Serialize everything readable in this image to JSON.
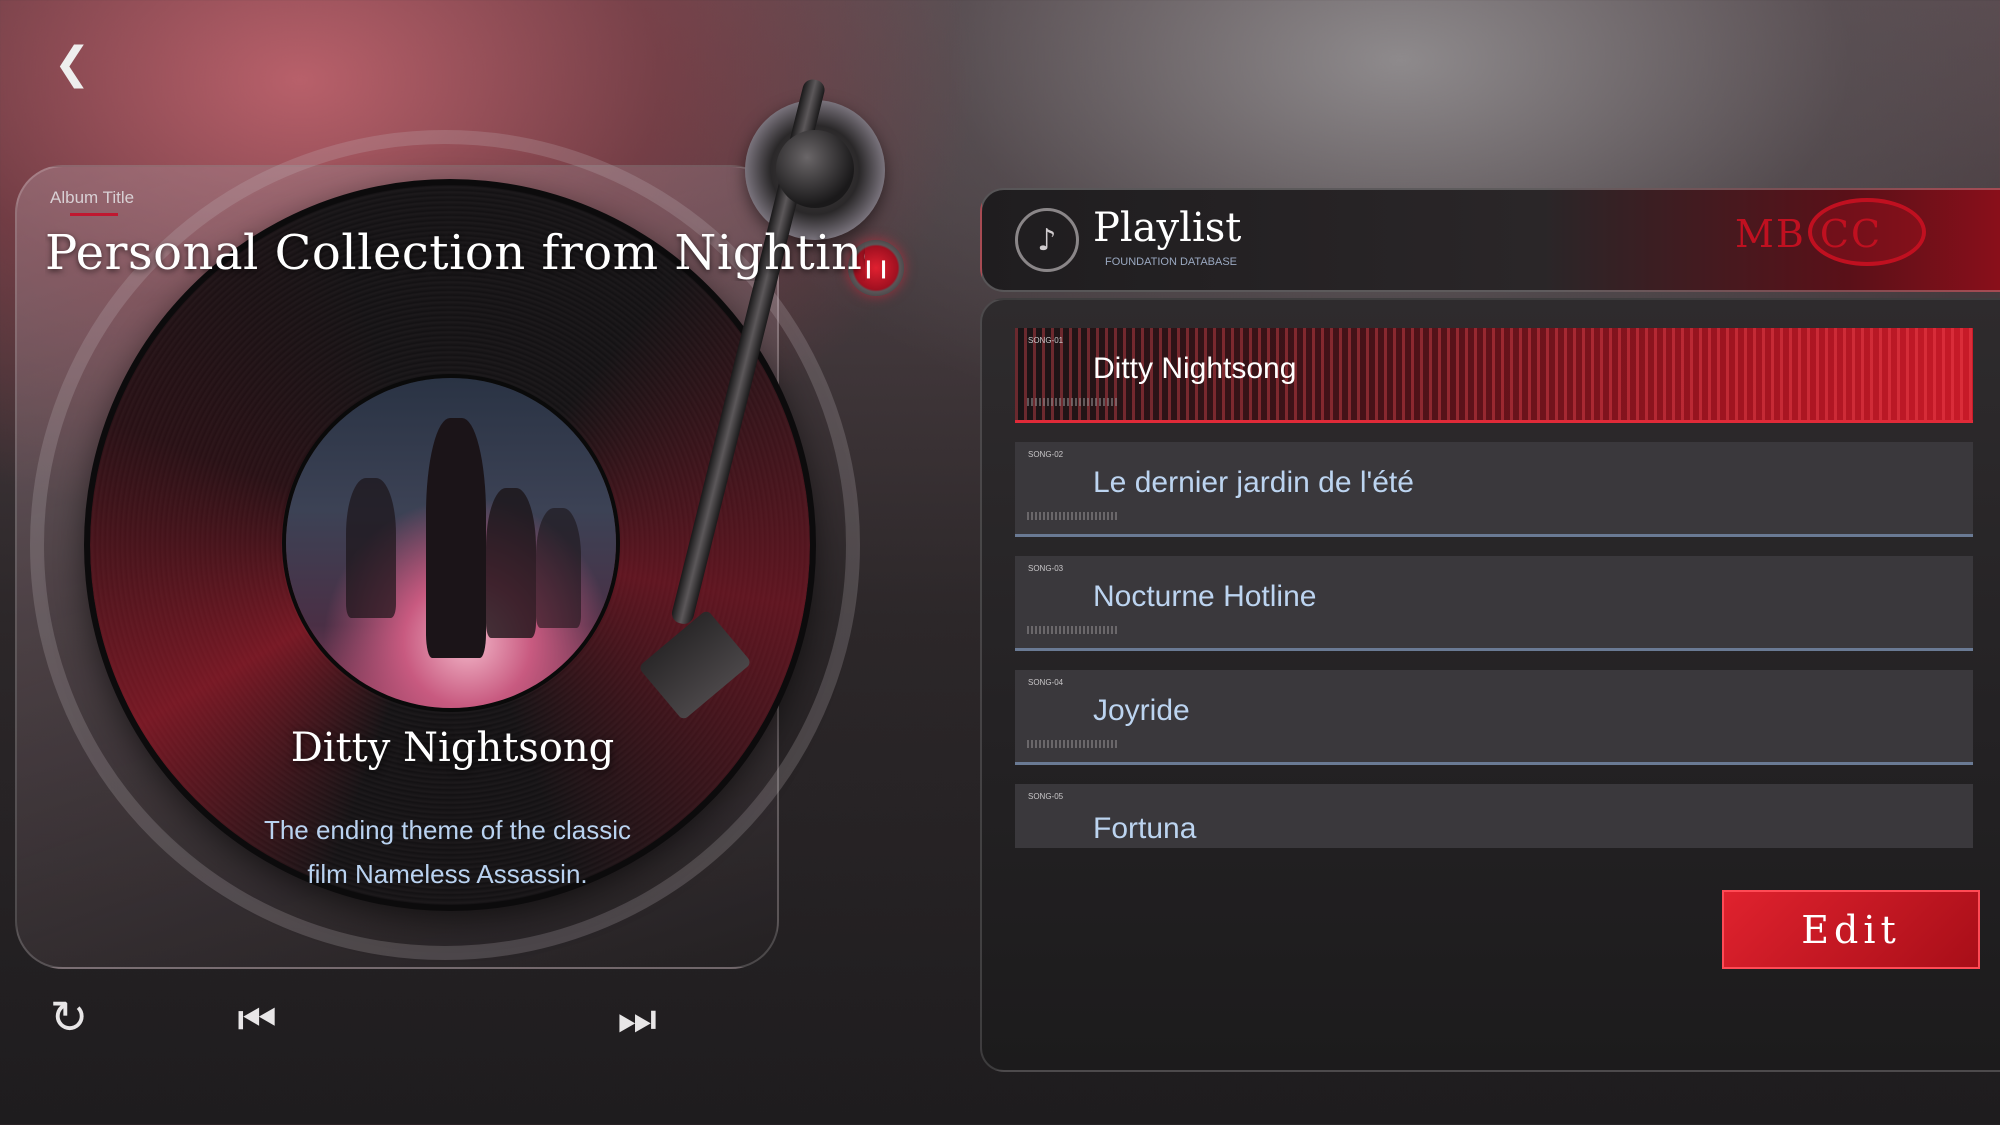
{
  "nav": {
    "back_icon": "back-chevron-icon"
  },
  "album": {
    "label": "Album Title",
    "title": "Personal Collection from Nightingale"
  },
  "now_playing": {
    "song_name": "Ditty Nightsong",
    "description": "The ending theme of the classic film Nameless Assassin."
  },
  "controls": {
    "repeat_icon": "repeat-icon",
    "prev_icon": "skip-previous-icon",
    "next_icon": "skip-next-icon"
  },
  "playlist": {
    "title": "Playlist",
    "subtitle": "FOUNDATION DATABASE",
    "logo_text": "MB CC",
    "tracks": [
      {
        "num": "SONG-01",
        "title": "Ditty Nightsong",
        "active": true
      },
      {
        "num": "SONG-02",
        "title": "Le dernier jardin de l'été",
        "active": false
      },
      {
        "num": "SONG-03",
        "title": "Nocturne Hotline",
        "active": false
      },
      {
        "num": "SONG-04",
        "title": "Joyride",
        "active": false
      },
      {
        "num": "SONG-05",
        "title": "Fortuna",
        "active": false
      }
    ],
    "edit_label": "Edit"
  },
  "colors": {
    "accent_red": "#c01020",
    "track_text": "#bcd4f0",
    "track_bg": "#3a383c"
  }
}
